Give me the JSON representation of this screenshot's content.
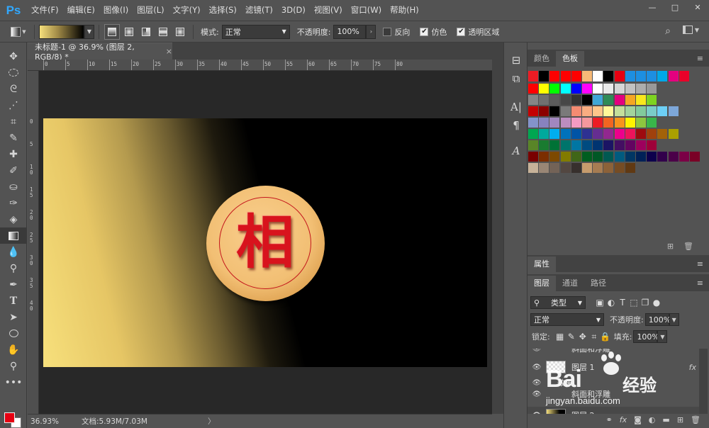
{
  "app": {
    "logo": "Ps"
  },
  "menu": [
    "文件(F)",
    "编辑(E)",
    "图像(I)",
    "图层(L)",
    "文字(Y)",
    "选择(S)",
    "滤镜(T)",
    "3D(D)",
    "视图(V)",
    "窗口(W)",
    "帮助(H)"
  ],
  "window_controls": {
    "minimize": "—",
    "maximize": "□",
    "close": "✕"
  },
  "options": {
    "mode_label": "模式:",
    "mode_value": "正常",
    "opacity_label": "不透明度:",
    "opacity_value": "100%",
    "reverse_label": "反向",
    "reverse_checked": false,
    "dither_label": "仿色",
    "dither_checked": true,
    "transparency_label": "透明区域",
    "transparency_checked": true
  },
  "document": {
    "tab_title": "未标题-1 @ 36.9% (图层 2, RGB/8) *",
    "close": "×",
    "piece_character": "相"
  },
  "ruler": {
    "h_ticks": [
      "0",
      "5",
      "10",
      "15",
      "20",
      "25",
      "30",
      "35",
      "40",
      "45",
      "50",
      "55",
      "60",
      "65",
      "70",
      "75",
      "80"
    ],
    "v_ticks": [
      "0",
      "5",
      "1\n0",
      "1\n5",
      "2\n0",
      "2\n5",
      "3\n0",
      "3\n5",
      "4\n0"
    ]
  },
  "status": {
    "zoom": "36.93%",
    "doc_info": "文档:5.93M/7.03M",
    "arrow": "〉"
  },
  "panels": {
    "color_tab": "颜色",
    "swatches_tab": "色板",
    "properties_tab": "属性",
    "layers_tab": "图层",
    "channels_tab": "通道",
    "paths_tab": "路径",
    "menu_icon": "≡"
  },
  "layers_panel": {
    "filter_kind": "类型",
    "blend_mode": "正常",
    "opacity_label": "不透明度:",
    "opacity_value": "100%",
    "lock_label": "锁定:",
    "fill_label": "填充:",
    "fill_value": "100%",
    "layers": [
      {
        "name": "斜面和浮雕",
        "kind": "effect",
        "visible": true
      },
      {
        "name": "图层 1",
        "kind": "layer",
        "visible": true,
        "fx": "fx"
      },
      {
        "name": "效果",
        "kind": "effects-header",
        "visible": true
      },
      {
        "name": "斜面和浮雕",
        "kind": "effect",
        "visible": true
      },
      {
        "name": "图层 2",
        "kind": "layer",
        "visible": true
      }
    ]
  },
  "watermark": {
    "brand": "Bai",
    "cn": "经验",
    "url": "jingyan.baidu.com"
  },
  "colors": {
    "foreground": "#e60012",
    "background": "#ffffff",
    "accent": "#31a8ff"
  }
}
